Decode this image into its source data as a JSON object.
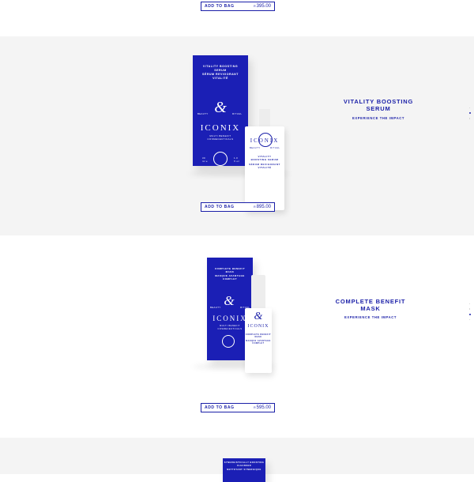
{
  "product_top": {
    "add_to_bag": "ADD TO BAG",
    "currency": "R",
    "price": "395.00"
  },
  "product_1": {
    "title_line1": "VITALITY BOOSTING",
    "title_line2": "SERUM",
    "subtitle": "EXPERIENCE THE IMPACT",
    "add_to_bag": "ADD TO BAG",
    "currency": "R",
    "price": "895.00",
    "box_text": [
      "VITALITY BOOSTING",
      "SERUM",
      "SÉRUM REVIGORANT",
      "VITALITÉ"
    ],
    "brand": "ICONIX",
    "monogram": "&",
    "tag_left": "BEAUTY",
    "tag_right": "RITUAL",
    "box_sub": [
      "MULTI BENEFIT",
      "COSMECEUTICALS"
    ],
    "box_vol_left": [
      "30",
      "ml e"
    ],
    "box_vol_right": [
      "1.0",
      "fl oz"
    ],
    "bottle_text": [
      "VITALITY",
      "BOOSTING SERUM",
      "SÉRUM REVIGORANT",
      "VITALITÉ"
    ]
  },
  "product_2": {
    "title_line1": "COMPLETE BENEFIT",
    "title_line2": "MASK",
    "subtitle": "EXPERIENCE THE IMPACT",
    "add_to_bag": "ADD TO BAG",
    "currency": "R",
    "price": "595.00",
    "box_text": [
      "COMPLETE BENEFIT",
      "MASK",
      "MASQUE AVANTAGE",
      "COMPLET"
    ],
    "brand": "ICONIX",
    "monogram": "&",
    "tag_left": "BEAUTY",
    "tag_right": "RITUAL",
    "box_sub": [
      "MULTI BENEFIT",
      "COSMECEUTICALS"
    ],
    "bottle_text": [
      "COMPLETE BENEFIT",
      "MASK",
      "MASQUE AVANTAGE",
      "COMPLET"
    ]
  },
  "product_3": {
    "box_text": [
      "SYNERGISTICALLY BOOSTING",
      "CLEANSER",
      "NETTOYANT SYNERGIQUE"
    ]
  },
  "colors": {
    "brand_blue": "#1b1fb5",
    "section_bg": "#f4f4f4"
  }
}
